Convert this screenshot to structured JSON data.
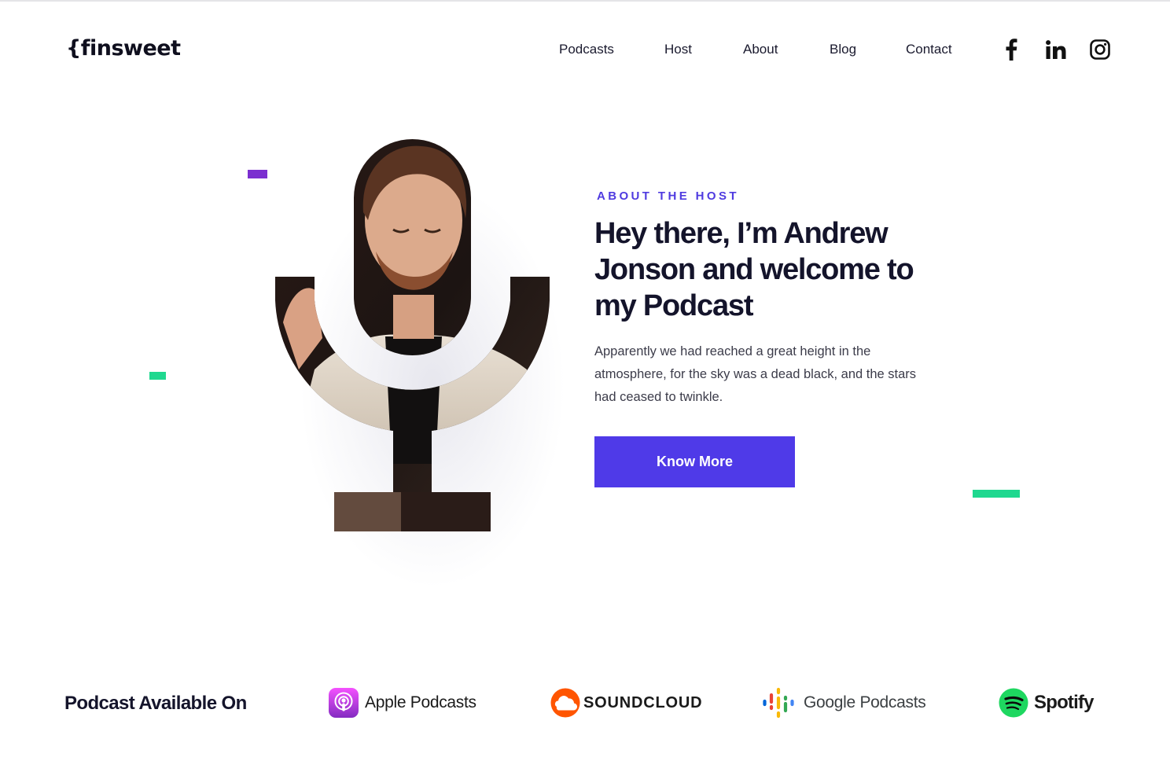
{
  "brand": {
    "logo_text": "{finsweet"
  },
  "nav": {
    "items": [
      "Podcasts",
      "Host",
      "About",
      "Blog",
      "Contact"
    ]
  },
  "social": {
    "icons": [
      "facebook-icon",
      "linkedin-icon",
      "instagram-icon"
    ]
  },
  "hero": {
    "eyebrow": "ABOUT THE HOST",
    "headline": "Hey there, I’m Andrew Jonson and welcome to my Podcast",
    "body": "Apparently we had reached a great height in the atmosphere, for the sky was a dead black, and the stars had ceased to twinkle.",
    "cta_label": "Know More"
  },
  "platforms": {
    "heading": "Podcast Available On",
    "items": [
      {
        "label": "Apple Podcasts",
        "icon": "apple-podcasts-icon"
      },
      {
        "label": "SOUNDCLOUD",
        "icon": "soundcloud-icon"
      },
      {
        "label": "Google Podcasts",
        "icon": "google-podcasts-icon"
      },
      {
        "label": "Spotify",
        "icon": "spotify-icon"
      }
    ]
  },
  "colors": {
    "accent": "#4f3ae8",
    "purple_deco": "#7b2fd0",
    "green_deco": "#1fd88f",
    "text_dark": "#14142b"
  }
}
